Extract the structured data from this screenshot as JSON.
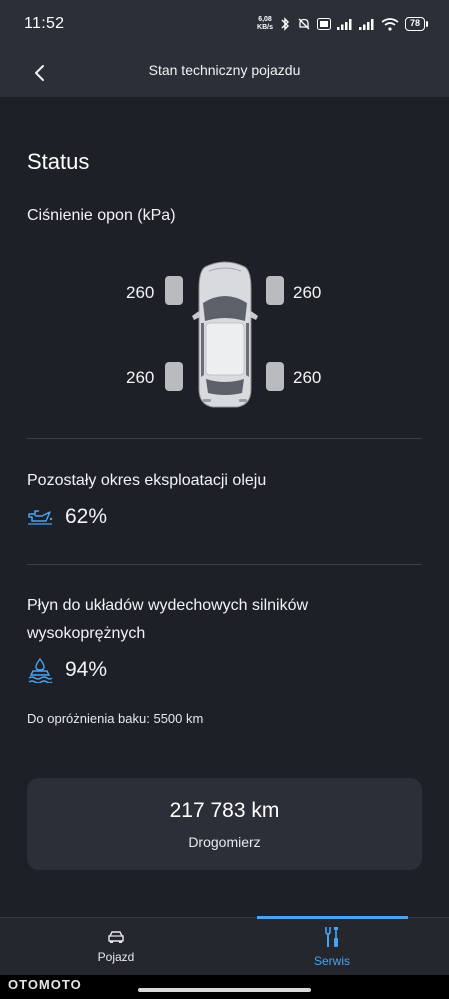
{
  "status_bar": {
    "time": "11:52",
    "net_speed_value": "6,08",
    "net_speed_unit": "KB/s",
    "battery": "78"
  },
  "header": {
    "title": "Stan techniczny pojazdu"
  },
  "status": {
    "title": "Status",
    "tire_pressure": {
      "label": "Ciśnienie opon (kPa)",
      "front_left": "260",
      "front_right": "260",
      "rear_left": "260",
      "rear_right": "260"
    },
    "oil_life": {
      "label": "Pozostały okres eksploatacji oleju",
      "value": "62%"
    },
    "exhaust_fluid": {
      "label_line1": "Płyn do układów wydechowych silników",
      "label_line2": "wysokoprężnych",
      "value": "94%",
      "range_text": "Do opróżnienia baku: 5500 km"
    },
    "odometer": {
      "value": "217 783 km",
      "label": "Drogomierz"
    }
  },
  "bottom_nav": {
    "items": [
      {
        "label": "Pojazd",
        "icon": "car-icon",
        "active": false
      },
      {
        "label": "Serwis",
        "icon": "wrench-screwdriver-icon",
        "active": true
      }
    ],
    "active_color": "#4aa3f0",
    "inactive_color": "#e8e9eb"
  },
  "watermark": "OTOMOTO",
  "colors": {
    "background": "#1d2027",
    "surface": "#2b2f37",
    "accent": "#4aa3f0"
  }
}
